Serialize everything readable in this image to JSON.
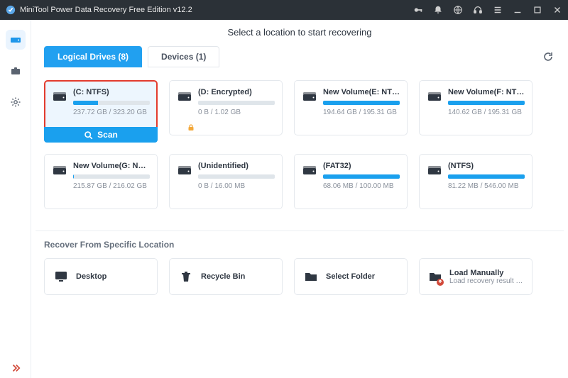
{
  "window": {
    "title": "MiniTool Power Data Recovery Free Edition v12.2"
  },
  "heading": "Select a location to start recovering",
  "tabs": {
    "logical": "Logical Drives (8)",
    "devices": "Devices (1)"
  },
  "scan_label": "Scan",
  "drives": [
    {
      "name": "(C: NTFS)",
      "size": "237.72 GB / 323.20 GB",
      "fill": 32,
      "selected": true
    },
    {
      "name": "(D: Encrypted)",
      "size": "0 B / 1.02 GB",
      "fill": 0,
      "locked": true
    },
    {
      "name": "New Volume(E: NTFS)",
      "size": "194.64 GB / 195.31 GB",
      "fill": 100
    },
    {
      "name": "New Volume(F: NTFS)",
      "size": "140.62 GB / 195.31 GB",
      "fill": 100
    },
    {
      "name": "New Volume(G: NTFS)",
      "size": "215.87 GB / 216.02 GB",
      "fill": 1
    },
    {
      "name": "(Unidentified)",
      "size": "0 B / 16.00 MB",
      "fill": 0
    },
    {
      "name": "(FAT32)",
      "size": "68.06 MB / 100.00 MB",
      "fill": 100
    },
    {
      "name": "(NTFS)",
      "size": "81.22 MB / 546.00 MB",
      "fill": 100
    }
  ],
  "section_title": "Recover From Specific Location",
  "locations": {
    "desktop": "Desktop",
    "recycle": "Recycle Bin",
    "folder": "Select Folder",
    "manual_title": "Load Manually",
    "manual_sub": "Load recovery result (*..."
  }
}
